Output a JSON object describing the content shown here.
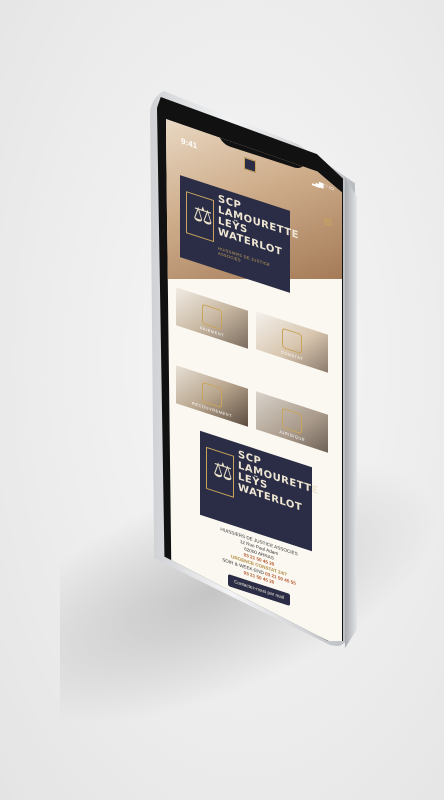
{
  "status": {
    "time": "9:41",
    "signal": "▂▄▆ ⌔ ▭"
  },
  "brand": {
    "line1": "SCP",
    "line2": "LAMOURETTE",
    "line3": "LEŸS",
    "line4": "WATERLOT",
    "subtitle": "HUISSIERS DE JUSTICE ASSOCIÉS"
  },
  "tiles": [
    {
      "label": "PAIEMENT"
    },
    {
      "label": "CONSTAT"
    },
    {
      "label": "RECOUVREMENT"
    },
    {
      "label": "JURIDIQUE"
    }
  ],
  "footer": {
    "address": "12 Rue Paul Adam",
    "city": "62000 ARRAS",
    "phone": "03 21 50 45 20",
    "urgency_label": "URGENCE CONSTAT 24/7",
    "urgency_hours": "SOIR & WEEK-END",
    "urgency_phone": "03 21 50 45 55",
    "phone2": "03 21 50 45 20",
    "contact_button": "Contactez-nous par mail"
  },
  "colors": {
    "navy": "#2a2d45",
    "gold": "#c9a45c",
    "cream": "#fbf8f1"
  }
}
